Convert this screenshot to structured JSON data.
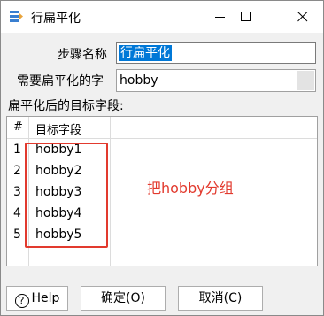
{
  "window": {
    "title": "行扁平化",
    "icons": {
      "app": "flatten-icon",
      "minimize": "minimize-icon",
      "maximize": "maximize-icon",
      "close": "close-icon"
    }
  },
  "form": {
    "step_name_label": "步骤名称",
    "step_name_value": "行扁平化",
    "field_label": "需要扁平化的字",
    "field_value": "hobby"
  },
  "target": {
    "label": "扁平化后的目标字段:",
    "columns": [
      "#",
      "目标字段"
    ],
    "rows": [
      {
        "num": "1",
        "value": "hobby1"
      },
      {
        "num": "2",
        "value": "hobby2"
      },
      {
        "num": "3",
        "value": "hobby3"
      },
      {
        "num": "4",
        "value": "hobby4"
      },
      {
        "num": "5",
        "value": "hobby5"
      }
    ]
  },
  "annotation": {
    "text": "把hobby分组",
    "color": "#e23a2e"
  },
  "buttons": {
    "help": "Help",
    "ok": "确定(O)",
    "cancel": "取消(C)"
  },
  "colors": {
    "selection": "#0078d7",
    "highlight": "#e23a2e"
  }
}
